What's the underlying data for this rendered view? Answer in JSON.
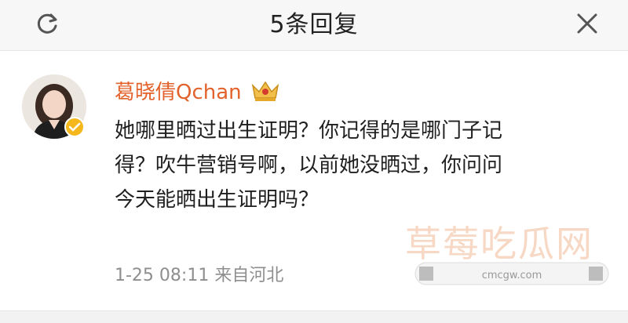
{
  "header": {
    "title": "5条回复",
    "refresh_icon": "refresh-icon",
    "close_icon": "close-icon"
  },
  "comment": {
    "username": "葛晓倩Qchan",
    "text_lines": [
      "她哪里晒过出生证明？你记得的是哪门子记",
      "得？吹牛营销号啊，以前她没晒过，你问问",
      "今天能晒出生证明吗？"
    ],
    "time": "1-25 08:11",
    "source": "来自河北",
    "badge_icon": "verified-badge-icon",
    "crown_icon": "crown-icon"
  },
  "watermark": {
    "text": "草莓吃瓜网",
    "url_text": "cmcgw.com"
  },
  "colors": {
    "username": "#e3622b",
    "header_bg": "#f7f7f7",
    "meta": "#8e8e8e"
  }
}
